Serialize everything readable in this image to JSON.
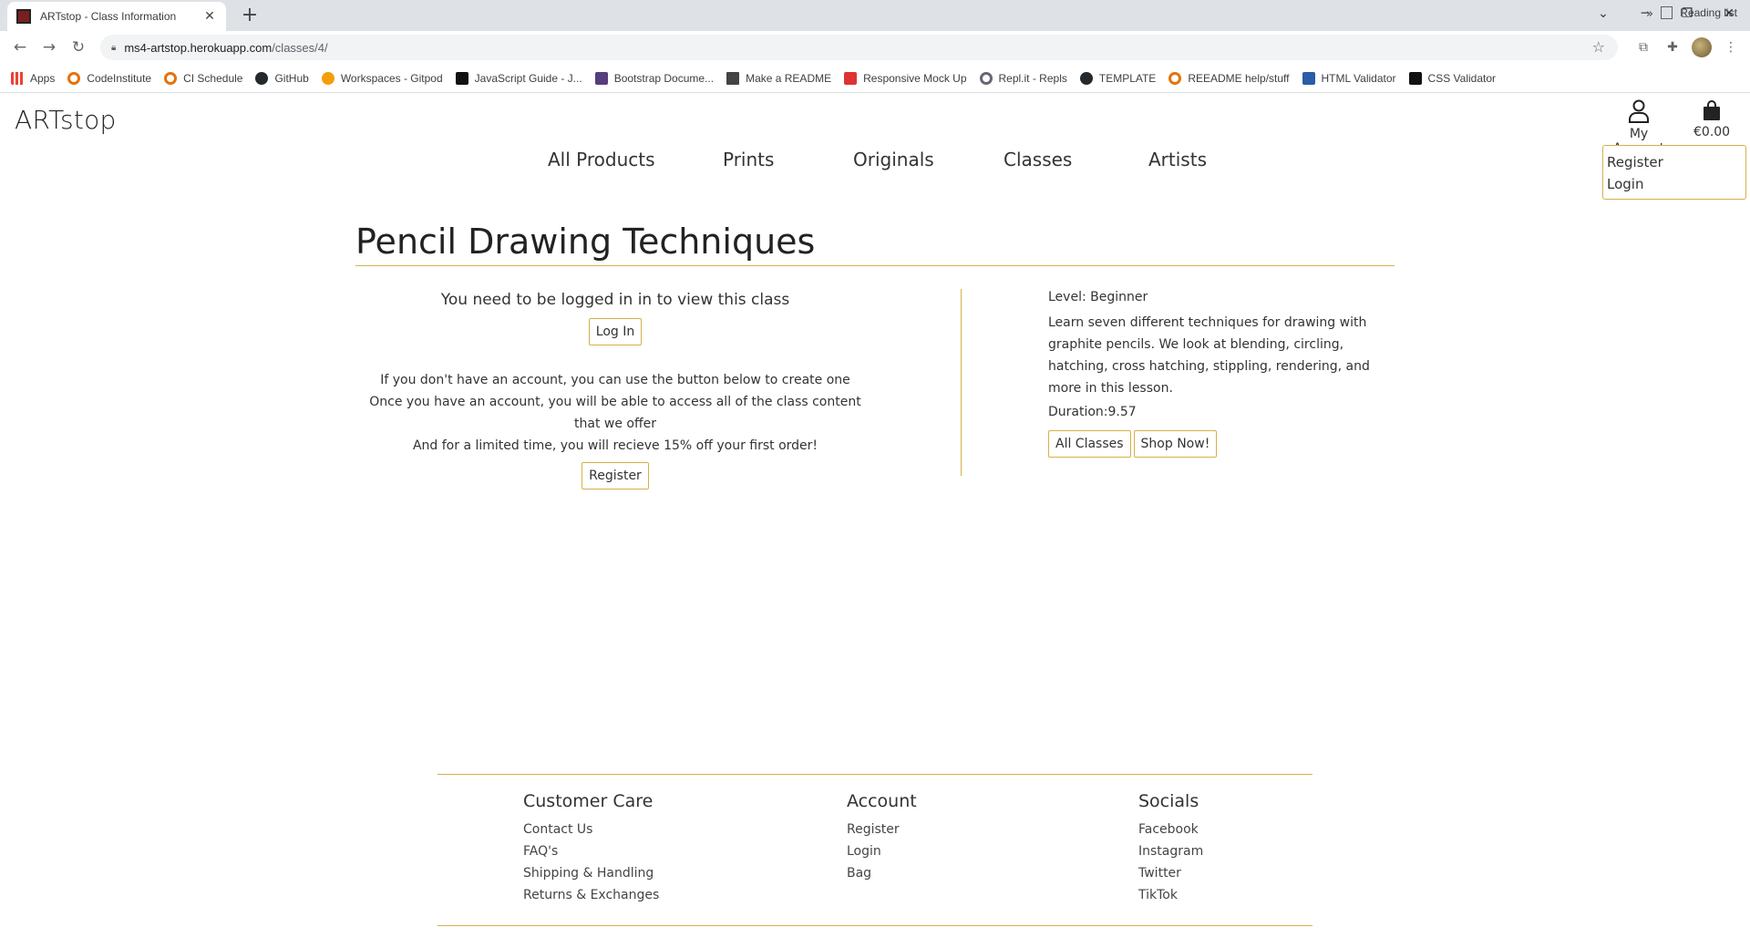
{
  "browser": {
    "tab_title": "ARTstop - Class Information",
    "url_host": "ms4-artstop.herokuapp.com",
    "url_path": "/classes/4/",
    "bookmarks": [
      {
        "label": "Apps",
        "icon": "apps"
      },
      {
        "label": "CodeInstitute",
        "icon": "ring"
      },
      {
        "label": "CI Schedule",
        "icon": "ring"
      },
      {
        "label": "GitHub",
        "icon": "gh"
      },
      {
        "label": "Workspaces - Gitpod",
        "icon": "gp"
      },
      {
        "label": "JavaScript Guide - J...",
        "icon": "js"
      },
      {
        "label": "Bootstrap Docume...",
        "icon": "bs"
      },
      {
        "label": "Make a README",
        "icon": "doc"
      },
      {
        "label": "Responsive Mock Up",
        "icon": "rm"
      },
      {
        "label": "Repl.it - Repls",
        "icon": "rp"
      },
      {
        "label": "TEMPLATE",
        "icon": "gh"
      },
      {
        "label": "REEADME help/stuff",
        "icon": "ring"
      },
      {
        "label": "HTML Validator",
        "icon": "w3"
      },
      {
        "label": "CSS Validator",
        "icon": "css"
      }
    ],
    "bookmarks_more": "»",
    "reading_list": "Reading list"
  },
  "header": {
    "logo": "ARTstop",
    "nav": [
      "All Products",
      "Prints",
      "Originals",
      "Classes",
      "Artists"
    ],
    "account_label": "My Account",
    "bag_total": "€0.00",
    "dropdown": [
      "Register",
      "Login"
    ]
  },
  "main": {
    "title": "Pencil Drawing Techniques",
    "login_notice": "You need to be logged in in to view this class",
    "login_button": "Log In",
    "info_lines": [
      "If you don't have an account, you can use the button below to create one",
      "Once you have an account, you will be able to access all of the class content that we offer",
      "And for a limited time, you will recieve 15% off your first order!"
    ],
    "register_button": "Register",
    "level": "Level: Beginner",
    "description": "Learn seven different techniques for drawing with graphite pencils. We look at blending, circling, hatching, cross hatching, stippling, rendering, and more in this lesson.",
    "duration": "Duration:9.57",
    "all_classes_button": "All Classes",
    "shop_button": "Shop Now!"
  },
  "footer": {
    "columns": [
      {
        "title": "Customer Care",
        "links": [
          "Contact Us",
          "FAQ's",
          "Shipping & Handling",
          "Returns & Exchanges"
        ]
      },
      {
        "title": "Account",
        "links": [
          "Register",
          "Login",
          "Bag"
        ]
      },
      {
        "title": "Socials",
        "links": [
          "Facebook",
          "Instagram",
          "Twitter",
          "TikTok"
        ]
      }
    ]
  },
  "colors": {
    "accent": "#d6b04a",
    "text": "#333333"
  }
}
